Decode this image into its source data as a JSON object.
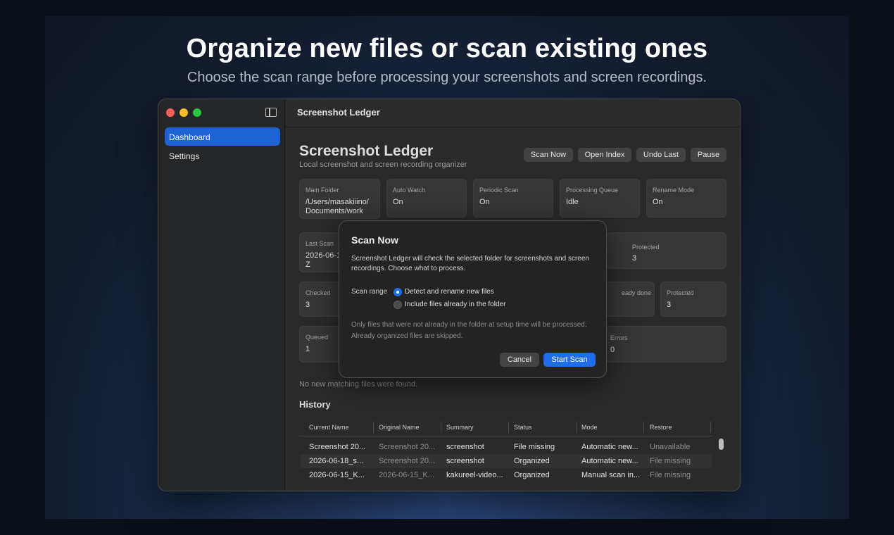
{
  "promo": {
    "headline": "Organize new files or scan existing ones",
    "subline": "Choose the scan range before processing your screenshots and screen recordings."
  },
  "window": {
    "title": "Screenshot Ledger"
  },
  "sidebar": {
    "items": [
      {
        "label": "Dashboard",
        "active": true
      },
      {
        "label": "Settings",
        "active": false
      }
    ]
  },
  "header": {
    "title": "Screenshot Ledger",
    "subtitle": "Local screenshot and screen recording organizer",
    "buttons": {
      "scan_now": "Scan Now",
      "open_index": "Open Index",
      "undo_last": "Undo Last",
      "pause": "Pause"
    }
  },
  "status_cards": {
    "main_folder": {
      "label": "Main Folder",
      "value": "/Users/masakiiino/\nDocuments/work"
    },
    "auto_watch": {
      "label": "Auto Watch",
      "value": "On"
    },
    "periodic_scan": {
      "label": "Periodic Scan",
      "value": "On"
    },
    "processing_queue": {
      "label": "Processing Queue",
      "value": "Idle"
    },
    "rename_mode": {
      "label": "Rename Mode",
      "value": "On"
    },
    "last_scan": {
      "label": "Last Scan",
      "value": "2026-06-1\nZ"
    },
    "protected_1": {
      "label": "Protected",
      "value": "3"
    },
    "checked": {
      "label": "Checked",
      "value": "3"
    },
    "already_done": {
      "label": "eady done",
      "value": ""
    },
    "protected_2": {
      "label": "Protected",
      "value": "3"
    },
    "queued": {
      "label": "Queued",
      "value": "1"
    },
    "errors": {
      "label": "Errors",
      "value": "0"
    }
  },
  "no_match_text": "No new matching files were found.",
  "history": {
    "title": "History",
    "columns": [
      "Current Name",
      "Original Name",
      "Summary",
      "Status",
      "Mode",
      "Restore"
    ],
    "rows": [
      {
        "current": "Screenshot 20...",
        "original": "Screenshot 20...",
        "summary": "screenshot",
        "status": "File missing",
        "mode": "Automatic new...",
        "restore": "Unavailable"
      },
      {
        "current": "2026-06-18_s...",
        "original": "Screenshot 20...",
        "summary": "screenshot",
        "status": "Organized",
        "mode": "Automatic new...",
        "restore": "File missing"
      },
      {
        "current": "2026-06-15_K...",
        "original": "2026-06-15_K...",
        "summary": "kakureel-video...",
        "status": "Organized",
        "mode": "Manual scan in...",
        "restore": "File missing"
      }
    ]
  },
  "modal": {
    "title": "Scan Now",
    "text": "Screenshot Ledger will check the selected folder for screenshots and screen recordings. Choose what to process.",
    "range_label": "Scan range",
    "options": [
      {
        "label": "Detect and rename new files",
        "selected": true
      },
      {
        "label": "Include files already in the folder",
        "selected": false
      }
    ],
    "note": "Only files that were not already in the folder at setup time will be processed. Already organized files are skipped.",
    "cancel_label": "Cancel",
    "start_label": "Start Scan"
  },
  "colors": {
    "accent": "#1f6ee8",
    "close": "#ff5f57",
    "minimize": "#febc2e",
    "zoom": "#28c840"
  }
}
